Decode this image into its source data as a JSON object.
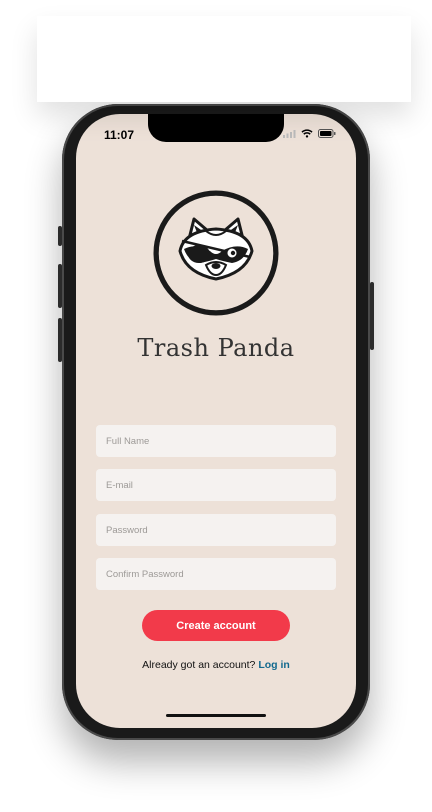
{
  "status_bar": {
    "time": "11:07",
    "icons": [
      "signal-icon",
      "wifi-icon",
      "battery-icon"
    ]
  },
  "app": {
    "title": "Trash Panda",
    "logo": "raccoon-logo-icon"
  },
  "form": {
    "full_name": {
      "placeholder": "Full Name",
      "value": ""
    },
    "email": {
      "placeholder": "E-mail",
      "value": ""
    },
    "password": {
      "placeholder": "Password",
      "value": ""
    },
    "confirm_password": {
      "placeholder": "Confirm Password",
      "value": ""
    }
  },
  "actions": {
    "create_account": "Create account",
    "login_prompt": "Already got an account?",
    "login_link": "Log in"
  },
  "colors": {
    "background": "#ede1d8",
    "field": "#f5f2f0",
    "primary_button": "#f23a4a",
    "link": "#12698e"
  }
}
